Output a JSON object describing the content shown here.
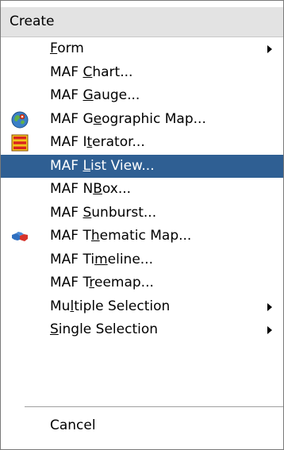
{
  "menu": {
    "header": "Create",
    "items": [
      {
        "pre": "",
        "mnemonic": "F",
        "post": "orm",
        "submenu": true
      },
      {
        "pre": "MAF ",
        "mnemonic": "C",
        "post": "hart...",
        "submenu": false
      },
      {
        "pre": "MAF ",
        "mnemonic": "G",
        "post": "auge...",
        "submenu": false
      },
      {
        "pre": "MAF G",
        "mnemonic": "e",
        "post": "ographic Map...",
        "submenu": false,
        "icon": "globe-icon"
      },
      {
        "pre": "MAF I",
        "mnemonic": "t",
        "post": "erator...",
        "submenu": false,
        "icon": "iterator-icon"
      },
      {
        "pre": "MAF ",
        "mnemonic": "L",
        "post": "ist View...",
        "submenu": false,
        "selected": true
      },
      {
        "pre": "MAF N",
        "mnemonic": "B",
        "post": "ox...",
        "submenu": false
      },
      {
        "pre": "MAF ",
        "mnemonic": "S",
        "post": "unburst...",
        "submenu": false
      },
      {
        "pre": "MAF T",
        "mnemonic": "h",
        "post": "ematic Map...",
        "submenu": false,
        "icon": "thematic-map-icon"
      },
      {
        "pre": "MAF Ti",
        "mnemonic": "m",
        "post": "eline...",
        "submenu": false
      },
      {
        "pre": "MAF T",
        "mnemonic": "r",
        "post": "eemap...",
        "submenu": false
      },
      {
        "pre": "Mu",
        "mnemonic": "l",
        "post": "tiple Selection",
        "submenu": true
      },
      {
        "pre": "",
        "mnemonic": "S",
        "post": "ingle Selection",
        "submenu": true
      }
    ],
    "cancel": "Cancel"
  },
  "colors": {
    "selection": "#2f5f93",
    "header_bg": "#e3e3e3"
  }
}
